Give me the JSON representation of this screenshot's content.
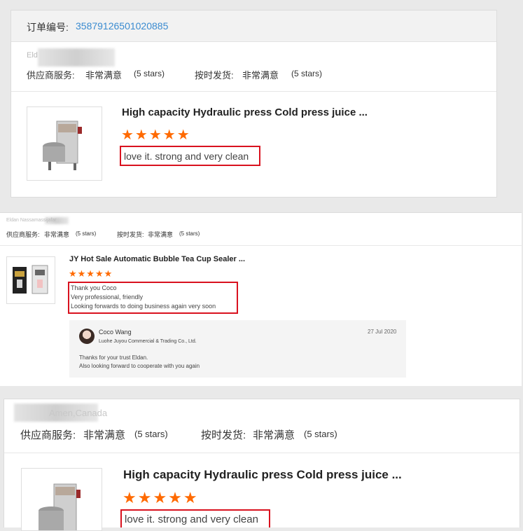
{
  "s1": {
    "order_label": "订单编号:",
    "order_number": "35879126501020885",
    "reviewer_name": "Eld",
    "supplier_label": "供应商服务:",
    "supplier_value": "非常满意",
    "supplier_stars": "(5 stars)",
    "shipping_label": "按时发货:",
    "shipping_value": "非常满意",
    "shipping_stars": "(5 stars)",
    "product_title": "High capacity Hydraulic press Cold press juice ...",
    "stars": "★★★★★",
    "review_text": "love it. strong and very clean"
  },
  "s2": {
    "reviewer_name": "Eldan Nassamassijafar",
    "supplier_label": "供应商服务:",
    "supplier_value": "非常满意",
    "supplier_stars": "(5 stars)",
    "shipping_label": "按时发货:",
    "shipping_value": "非常满意",
    "shipping_stars": "(5 stars)",
    "product_title": "JY Hot Sale Automatic Bubble Tea Cup Sealer ...",
    "stars": "★★★★★",
    "review_lines": [
      "Thank you Coco",
      "Very professional, friendly",
      "Looking forwards to doing business again very soon"
    ],
    "reply": {
      "name": "Coco Wang",
      "date": "27 Jul 2020",
      "company": "Luohe Juyou Commercial & Trading Co., Ltd.",
      "lines": [
        "Thanks for your trust Eldan.",
        "Also looking forward to cooperate with you again"
      ]
    }
  },
  "s3": {
    "reviewer_name": "Amen,Canada",
    "supplier_label": "供应商服务:",
    "supplier_value": "非常满意",
    "supplier_stars": "(5 stars)",
    "shipping_label": "按时发货:",
    "shipping_value": "非常满意",
    "shipping_stars": "(5 stars)",
    "product_title": "High capacity Hydraulic press Cold press juice ...",
    "stars": "★★★★★",
    "review_text": "love it. strong and very clean"
  },
  "colors": {
    "accent_star": "#ff6a00",
    "link_blue": "#3a8bd0",
    "highlight_red": "#d9121f"
  }
}
